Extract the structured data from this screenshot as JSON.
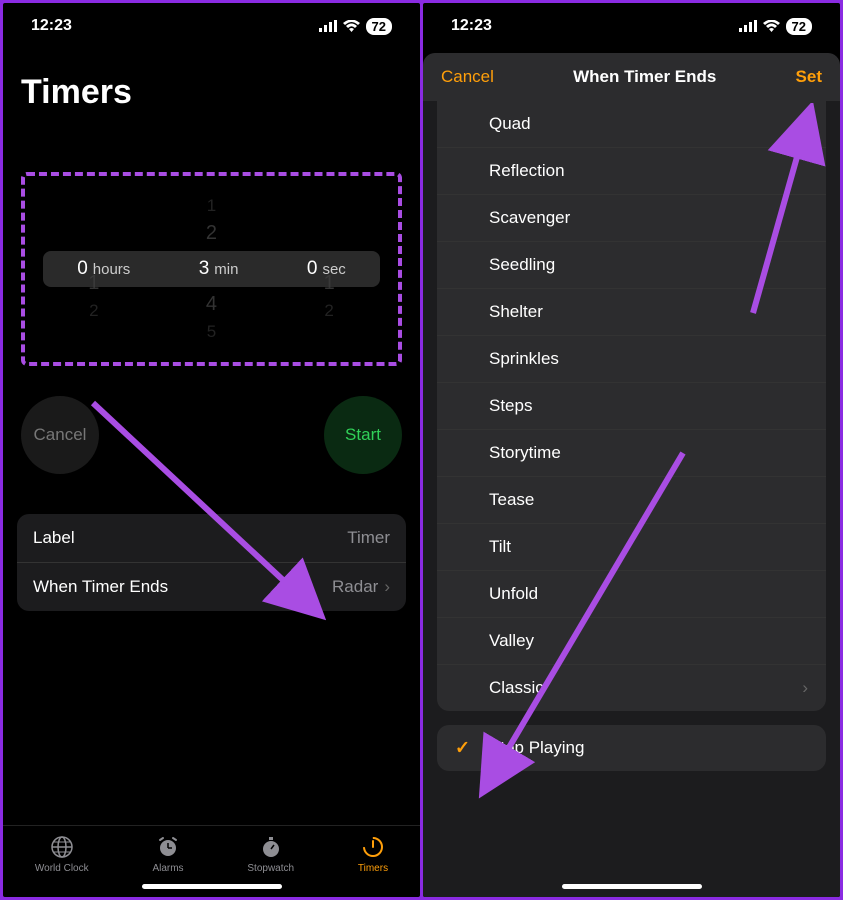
{
  "status": {
    "time": "12:23",
    "battery": "72"
  },
  "left": {
    "title": "Timers",
    "picker": {
      "hours": {
        "value": "0",
        "unit": "hours",
        "above": "",
        "above2": "",
        "below": "1",
        "below2": "2"
      },
      "minutes": {
        "value": "3",
        "unit": "min",
        "above": "2",
        "above2": "1",
        "below": "4",
        "below2": "5"
      },
      "seconds": {
        "value": "0",
        "unit": "sec",
        "above": "",
        "above2": "",
        "below": "1",
        "below2": "2"
      }
    },
    "cancel": "Cancel",
    "start": "Start",
    "labelRow": {
      "label": "Label",
      "value": "Timer"
    },
    "endsRow": {
      "label": "When Timer Ends",
      "value": "Radar"
    },
    "tabs": {
      "worldClock": "World Clock",
      "alarms": "Alarms",
      "stopwatch": "Stopwatch",
      "timers": "Timers"
    }
  },
  "right": {
    "cancel": "Cancel",
    "title": "When Timer Ends",
    "set": "Set",
    "sounds": [
      "Quad",
      "Reflection",
      "Scavenger",
      "Seedling",
      "Shelter",
      "Sprinkles",
      "Steps",
      "Storytime",
      "Tease",
      "Tilt",
      "Unfold",
      "Valley",
      "Classic"
    ],
    "stopPlaying": "Stop Playing"
  }
}
